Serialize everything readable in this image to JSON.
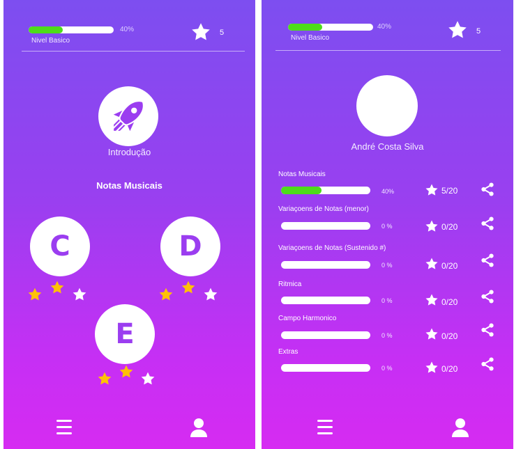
{
  "left": {
    "level": {
      "label": "Nivel Basico",
      "progress": 0.4,
      "percent_text": "40%"
    },
    "star_count": "5",
    "intro": {
      "label": "Introdução",
      "icon": "rocket-icon"
    },
    "section_title": "Notas Musicais",
    "notes": [
      {
        "letter": "C",
        "stars": [
          true,
          true,
          false
        ]
      },
      {
        "letter": "D",
        "stars": [
          true,
          true,
          false
        ]
      },
      {
        "letter": "E",
        "stars": [
          true,
          true,
          false
        ]
      }
    ],
    "nav": {
      "menu_icon": "hamburger-menu-icon",
      "profile_icon": "user-icon"
    }
  },
  "right": {
    "level": {
      "label": "Nivel Basico",
      "progress": 0.4,
      "percent_text": "40%"
    },
    "star_count": "5",
    "profile": {
      "name": "André Costa Silva"
    },
    "stats": [
      {
        "label": "Notas Musicais",
        "progress": 0.45,
        "percent_text": "40%",
        "score": "5/20"
      },
      {
        "label": "Variaçoens de Notas (menor)",
        "progress": 0,
        "percent_text": "0 %",
        "score": "0/20"
      },
      {
        "label": "Variaçoens de Notas (Sustenido #)",
        "progress": 0,
        "percent_text": "0 %",
        "score": "0/20"
      },
      {
        "label": "Ritmica",
        "progress": 0,
        "percent_text": "0 %",
        "score": "0/20"
      },
      {
        "label": "Campo Harmonico",
        "progress": 0,
        "percent_text": "0 %",
        "score": "0/20"
      },
      {
        "label": "Extras",
        "progress": 0,
        "percent_text": "0 %",
        "score": "0/20"
      }
    ],
    "nav": {
      "menu_icon": "hamburger-menu-icon",
      "profile_icon": "user-icon"
    }
  },
  "colors": {
    "accent": "#9b3df0",
    "progress": "#4ddc1a",
    "gold_star": "#ffc107",
    "white": "#ffffff"
  }
}
